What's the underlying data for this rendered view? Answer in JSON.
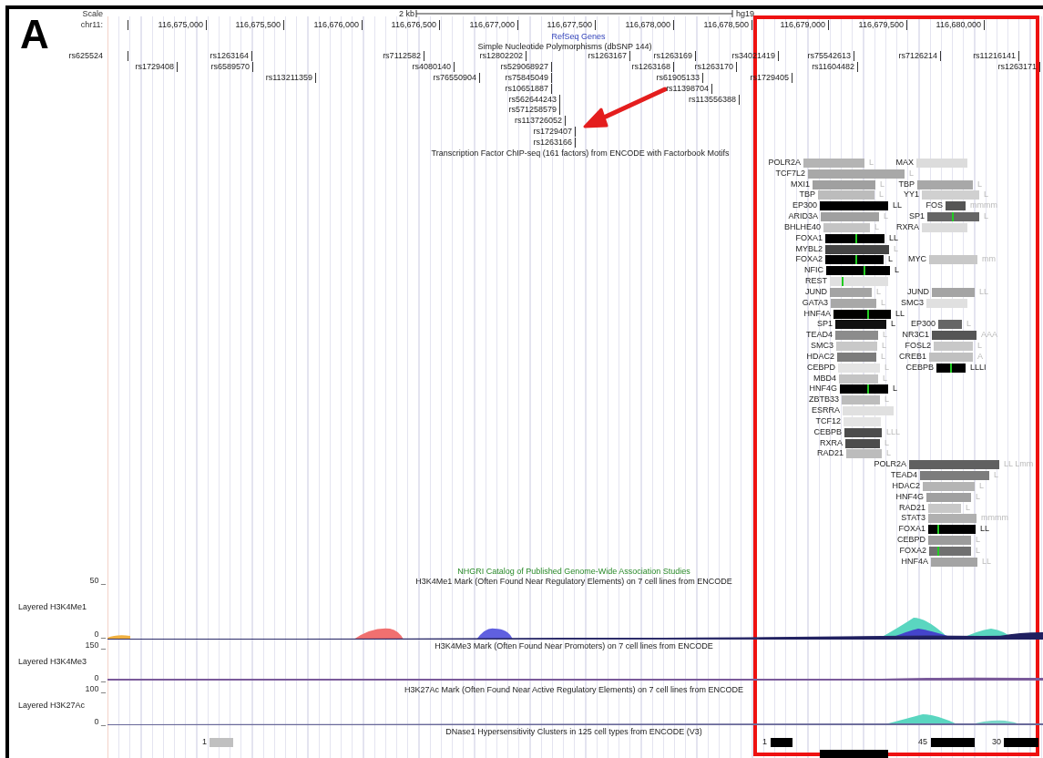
{
  "panel_label": "A",
  "scale": {
    "label": "Scale",
    "length": "2 kb",
    "assembly": "hg19"
  },
  "ruler": {
    "label": "chr11:",
    "ticks": [
      "116,675,000",
      "116,675,500",
      "116,676,000",
      "116,676,500",
      "116,677,000",
      "116,677,500",
      "116,678,000",
      "116,678,500",
      "116,679,000",
      "116,679,500",
      "116,680,000"
    ]
  },
  "refseq_track": {
    "title": "RefSeq Genes"
  },
  "snp_track": {
    "title": "Simple Nucleotide Polymorphisms (dbSNP 144)",
    "markers": [
      "rs625524",
      "rs1263164",
      "rs7112582",
      "rs12802202",
      "rs1263167",
      "rs1263169",
      "rs34021419",
      "rs75542613",
      "rs7126214",
      "rs11216141",
      "rs1729408",
      "rs6589570",
      "rs4080140",
      "rs529068927",
      "rs1263168",
      "rs1263170",
      "rs11604482",
      "rs1263171",
      "rs113211359",
      "rs76550904",
      "rs75845049",
      "rs61905133",
      "rs1729405",
      "rs10651887",
      "rs11398704",
      "rs562644243",
      "rs113556388",
      "rs571258579",
      "rs113726052",
      "rs1729407",
      "rs1263166"
    ]
  },
  "tf_track": {
    "title": "Transcription Factor ChIP-seq (161 factors) from ENCODE with Factorbook Motifs",
    "factors": [
      {
        "name": "POLR2A",
        "color": "#b4b4b4",
        "suffix": "L",
        "motif": false
      },
      {
        "name": "MAX",
        "color": "#dcdcdc",
        "motif": false
      },
      {
        "name": "TCF7L2",
        "color": "#a8a8a8",
        "suffix": "L",
        "motif": false
      },
      {
        "name": "MXI1",
        "color": "#a0a0a0",
        "suffix": "L",
        "motif": false
      },
      {
        "name": "TBP",
        "color": "#a8a8a8",
        "suffix": "L",
        "motif": false
      },
      {
        "name": "TBP",
        "color": "#bcbcbc",
        "suffix": "L",
        "motif": false
      },
      {
        "name": "YY1",
        "color": "#d0d0d0",
        "suffix": "L",
        "motif": false
      },
      {
        "name": "EP300",
        "color": "#000000",
        "suffix": "LL",
        "motif": false
      },
      {
        "name": "FOS",
        "color": "#555555",
        "suffix": "mmmm",
        "motif": false
      },
      {
        "name": "ARID3A",
        "color": "#a0a0a0",
        "suffix": "L",
        "motif": false
      },
      {
        "name": "SP1",
        "color": "#666666",
        "suffix": "L",
        "motif": true
      },
      {
        "name": "BHLHE40",
        "color": "#c4c4c4",
        "suffix": "L",
        "motif": false
      },
      {
        "name": "RXRA",
        "color": "#dcdcdc",
        "motif": false
      },
      {
        "name": "FOXA1",
        "color": "#000000",
        "suffix": "LL",
        "motif": true
      },
      {
        "name": "MYBL2",
        "color": "#444444",
        "suffix": "L",
        "motif": false
      },
      {
        "name": "FOXA2",
        "color": "#000000",
        "suffix": "L",
        "motif": true
      },
      {
        "name": "MYC",
        "color": "#c8c8c8",
        "suffix": "mm",
        "motif": false
      },
      {
        "name": "NFIC",
        "color": "#000000",
        "suffix": "L",
        "motif": true
      },
      {
        "name": "REST",
        "color": "#e0e0e0",
        "motif": true
      },
      {
        "name": "JUND",
        "color": "#a4a4a4",
        "suffix": "L",
        "motif": false
      },
      {
        "name": "JUND",
        "color": "#a4a4a4",
        "suffix": "LL",
        "motif": false
      },
      {
        "name": "GATA3",
        "color": "#a8a8a8",
        "suffix": "L",
        "motif": false
      },
      {
        "name": "SMC3",
        "color": "#e0e0e0",
        "motif": false
      },
      {
        "name": "HNF4A",
        "color": "#000000",
        "suffix": "LL",
        "motif": true
      },
      {
        "name": "SP1",
        "color": "#111111",
        "suffix": "L",
        "motif": false
      },
      {
        "name": "EP300",
        "color": "#666666",
        "suffix": "L",
        "motif": false
      },
      {
        "name": "TEAD4",
        "color": "#8c8c8c",
        "suffix": "L",
        "motif": false
      },
      {
        "name": "NR3C1",
        "color": "#555555",
        "suffix": "AAA",
        "motif": false
      },
      {
        "name": "SMC3",
        "color": "#c8c8c8",
        "suffix": "L",
        "motif": false
      },
      {
        "name": "FOSL2",
        "color": "#c8c8c8",
        "suffix": "L",
        "motif": false
      },
      {
        "name": "HDAC2",
        "color": "#7c7c7c",
        "suffix": "L",
        "motif": false
      },
      {
        "name": "CREB1",
        "color": "#c0c0c0",
        "suffix": "A",
        "motif": false
      },
      {
        "name": "CEBPD",
        "color": "#e4e4e4",
        "suffix": "L",
        "motif": false
      },
      {
        "name": "CEBPB",
        "color": "#000000",
        "suffix": "LLLI",
        "motif": true
      },
      {
        "name": "MBD4",
        "color": "#c4c4c4",
        "suffix": "L",
        "motif": false
      },
      {
        "name": "HNF4G",
        "color": "#000000",
        "suffix": "L",
        "motif": true
      },
      {
        "name": "ZBTB33",
        "color": "#bcbcbc",
        "suffix": "L",
        "motif": false
      },
      {
        "name": "ESRRA",
        "color": "#e0e0e0",
        "motif": false
      },
      {
        "name": "TCF12",
        "color": "#e4e4e4",
        "motif": false
      },
      {
        "name": "CEBPB",
        "color": "#4c4c4c",
        "suffix": "LLL",
        "motif": false
      },
      {
        "name": "RXRA",
        "color": "#4c4c4c",
        "suffix": "L",
        "motif": false
      },
      {
        "name": "RAD21",
        "color": "#bcbcbc",
        "suffix": "L",
        "motif": false
      },
      {
        "name": "POLR2A",
        "color": "#606060",
        "suffix": "LL Lmm",
        "motif": false
      },
      {
        "name": "TEAD4",
        "color": "#7c7c7c",
        "suffix": "L",
        "motif": false
      },
      {
        "name": "HDAC2",
        "color": "#b4b4b4",
        "suffix": "L",
        "motif": false
      },
      {
        "name": "HNF4G",
        "color": "#a0a0a0",
        "suffix": "L",
        "motif": false
      },
      {
        "name": "RAD21",
        "color": "#c8c8c8",
        "suffix": "L",
        "motif": false
      },
      {
        "name": "STAT3",
        "color": "#b0b0b0",
        "suffix": "mmmm",
        "motif": false
      },
      {
        "name": "FOXA1",
        "color": "#000000",
        "suffix": "LL",
        "motif": true
      },
      {
        "name": "CEBPD",
        "color": "#9c9c9c",
        "suffix": "L",
        "motif": false
      },
      {
        "name": "FOXA2",
        "color": "#707070",
        "suffix": "L",
        "motif": true
      },
      {
        "name": "HNF4A",
        "color": "#a4a4a4",
        "suffix": "LL",
        "motif": false
      }
    ]
  },
  "gwas_track": {
    "title": "NHGRI Catalog of Published Genome-Wide Association Studies"
  },
  "signal_tracks": [
    {
      "title": "H3K4Me1 Mark (Often Found Near Regulatory Elements) on 7 cell lines from ENCODE",
      "label": "Layered H3K4Me1",
      "max": "50 _",
      "min": "0 _"
    },
    {
      "title": "H3K4Me3 Mark (Often Found Near Promoters) on 7 cell lines from ENCODE",
      "label": "Layered H3K4Me3",
      "max": "150 _",
      "min": "0 _"
    },
    {
      "title": "H3K27Ac Mark (Often Found Near Active Regulatory Elements) on 7 cell lines from ENCODE",
      "label": "Layered H3K27Ac",
      "max": "100 _",
      "min": "0 _"
    }
  ],
  "dnase_track": {
    "title": "DNase1 Hypersensitivity Clusters in 125 cell types from ENCODE (V3)",
    "clusters": [
      {
        "score": "1",
        "color": "#c0c0c0"
      },
      {
        "score": "1",
        "color": "#000000"
      },
      {
        "score": "45",
        "color": "#000000"
      },
      {
        "score": "30",
        "color": "#000000"
      }
    ]
  }
}
